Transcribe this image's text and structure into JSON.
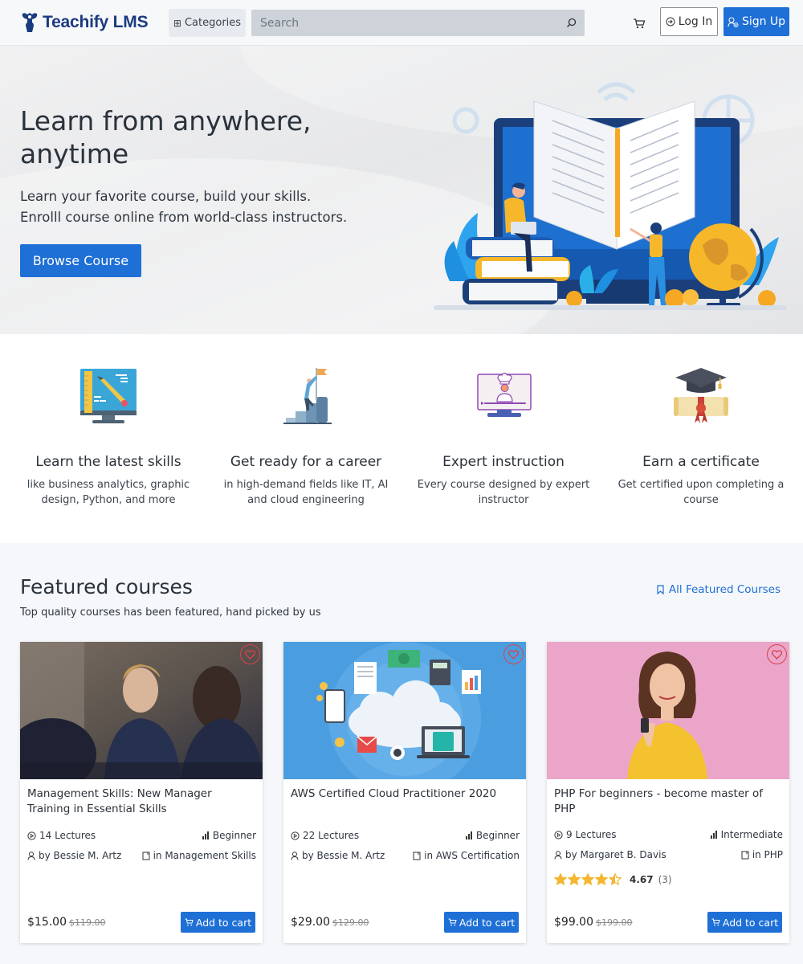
{
  "header": {
    "brand": "Teachify LMS",
    "categories_label": "Categories",
    "search_placeholder": "Search",
    "login_label": "Log In",
    "signup_label": "Sign Up"
  },
  "hero": {
    "title": "Learn from anywhere, anytime",
    "subtitle_line1": "Learn your favorite course, build your skills.",
    "subtitle_line2": "Enrolll course online from world-class instructors.",
    "cta_label": "Browse Course"
  },
  "features": [
    {
      "title": "Learn the latest skills",
      "desc": "like business analytics, graphic design, Python, and more",
      "icon": "monitor-pencil-icon"
    },
    {
      "title": "Get ready for a career",
      "desc": "in high-demand fields like IT, AI and cloud engineering",
      "icon": "career-flag-icon"
    },
    {
      "title": "Expert instruction",
      "desc": "Every course designed by expert instructor",
      "icon": "video-instructor-icon"
    },
    {
      "title": "Earn a certificate",
      "desc": "Get certified upon completing a course",
      "icon": "graduation-certificate-icon"
    }
  ],
  "featured": {
    "title": "Featured courses",
    "subtitle": "Top quality courses has been featured, hand picked by us",
    "all_link": "All Featured Courses",
    "courses": [
      {
        "title": "Management Skills: New Manager Training in Essential Skills",
        "lectures": "14 Lectures",
        "level": "Beginner",
        "author": "by Bessie M. Artz",
        "category": "in Management Skills",
        "price": "$15.00",
        "old_price": "$119.00",
        "cart_label": "Add to cart",
        "image": "business-meeting-photo"
      },
      {
        "title": "AWS Certified Cloud Practitioner 2020",
        "lectures": "22 Lectures",
        "level": "Beginner",
        "author": "by Bessie M. Artz",
        "category": "in AWS Certification",
        "price": "$29.00",
        "old_price": "$129.00",
        "cart_label": "Add to cart",
        "image": "cloud-computing-illustration"
      },
      {
        "title": "PHP For beginners - become master of PHP",
        "lectures": "9 Lectures",
        "level": "Intermediate",
        "author": "by Margaret B. Davis",
        "category": "in PHP",
        "rating": 4.67,
        "rating_label": "4.67",
        "rating_count": "(3)",
        "price": "$99.00",
        "old_price": "$199.00",
        "cart_label": "Add to cart",
        "image": "woman-with-phone-photo"
      }
    ]
  },
  "colors": {
    "brand_navy": "#1b3b80",
    "primary_blue": "#1e6fd6",
    "favorite_red": "#d7444f",
    "star_gold": "#f5b731"
  }
}
